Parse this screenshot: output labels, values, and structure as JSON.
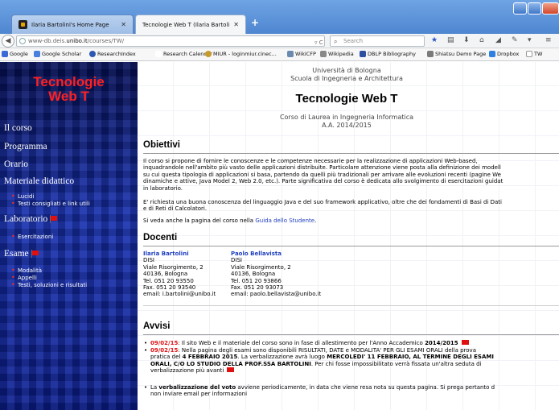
{
  "browser": {
    "tabs": [
      {
        "title": "Ilaria Bartolini's Home Page"
      },
      {
        "title": "Tecnologie Web T (Ilaria Bartolini)"
      }
    ],
    "new_tab": "+",
    "url_prefix": "www-db.deis.",
    "url_domain": "unibo.it",
    "url_path": "/courses/TW/",
    "search_placeholder": "Search",
    "bookmarks": [
      {
        "label": "Google",
        "color": "#3b6ad6"
      },
      {
        "label": "Google Scholar",
        "color": "#4a7fe0"
      },
      {
        "label": "ResearchIndex",
        "color": "#2c58b0"
      },
      {
        "label": "Research Calendar",
        "color": "#ffffff"
      },
      {
        "label": "MIUR - loginmiur.cinec...",
        "color": "#c79a2a"
      },
      {
        "label": "WikiCFP",
        "color": "#6a8ab0"
      },
      {
        "label": "Wikipedia",
        "color": "#888888"
      },
      {
        "label": "DBLP Bibliography",
        "color": "#2d4fa0"
      },
      {
        "label": "Shiatsu Demo Page",
        "color": "#7a7a7a"
      },
      {
        "label": "Dropbox",
        "color": "#2f7fe0"
      },
      {
        "label": "TW",
        "color": "#ffffff"
      }
    ]
  },
  "sidebar": {
    "site_title_line1": "Tecnologie",
    "site_title_line2": "Web T",
    "nav": {
      "corso": "Il corso",
      "programma": "Programma",
      "orario": "Orario",
      "materiale": "Materiale didattico",
      "lucidi": "Lucidi",
      "testi": "Testi consigliati e link utili",
      "laboratorio": "Laboratorio",
      "esercitazioni": "Esercitazioni",
      "esame": "Esame",
      "modalita": "Modalità",
      "appelli": "Appelli",
      "soluzioni": "Testi, soluzioni e risultati"
    }
  },
  "main": {
    "university": "Università di Bologna",
    "school": "Scuola di Ingegneria e Architettura",
    "title": "Tecnologie Web T",
    "degree": "Corso di Laurea in Ingegneria Informatica",
    "year": "A.A. 2014/2015",
    "obiettivi": {
      "heading": "Obiettivi",
      "p1_lines": [
        "Il corso si propone di fornire le conoscenze e le competenze necessarie per la realizzazione di applicazioni Web-based,",
        "inquadrandole nell'ambito più vasto delle applicazioni distribuite. Particolare attenzione viene posta alla definizione dei modell",
        "su cui questa tipologia di applicazioni si basa, partendo da quelli più tradizionali per arrivare alle evoluzioni recenti (pagine We",
        "dinamiche e attive, Java Model 2, Web 2.0, etc.). Parte significativa del corso è dedicata allo svolgimento di esercitazioni guidat",
        "in laboratorio."
      ],
      "p2_lines": [
        "E' richiesta una buona conoscenza del linguaggio Java e del suo framework applicativo, oltre che dei fondamenti di Basi di Dati",
        "e di Reti di Calcolatori."
      ],
      "p3_prefix": "Si veda anche la pagina del corso nella ",
      "p3_link": "Guida dello Studente",
      "p3_suffix": "."
    },
    "docenti": {
      "heading": "Docenti",
      "list": [
        {
          "name": "Ilaria Bartolini",
          "dept": "DISI",
          "street": "Viale Risorgimento, 2",
          "city": "40136, Bologna",
          "tel": "Tel. 051 20 93550",
          "fax": "Fax. 051 20 93540",
          "email": "email: i.bartolini@unibo.it"
        },
        {
          "name": "Paolo Bellavista",
          "dept": "DISI",
          "street": "Viale Risorgimento, 2",
          "city": "40136, Bologna",
          "tel": "Tel. 051 20 93866",
          "fax": "Fax. 051 20 93073",
          "email": "email: paolo.bellavista@unibo.it"
        }
      ]
    },
    "avvisi": {
      "heading": "Avvisi",
      "a1_date": "09/02/15",
      "a1_text": ": Il sito Web e il materiale del corso sono in fase di allestimento per l'Anno Accademico ",
      "a1_bold": "2014/2015",
      "a2_date": "09/02/15",
      "a2_l1": ": Nella pagina degli esami sono disponibili RISULTATI, DATE e MODALITA' PER GLI ESAMI ORALI della prova",
      "a2_l2a": "pratica del ",
      "a2_l2b": "4 FEBBRAIO 2015",
      "a2_l2c": ". La verbalizzazione avrà luogo ",
      "a2_l2d": "MERCOLEDI' 11 FEBBRAIO, AL TERMINE DEGLI ESAMI",
      "a2_l3a": "ORALI, C/O LO STUDIO DELLA PROF.SSA BARTOLINI",
      "a2_l3b": ". Per chi fosse impossibilitato verrà fissata un'altra seduta di",
      "a2_l4": "verbalizzazione più avanti",
      "a3_pre": "La ",
      "a3_bold": "verbalizzazione del voto",
      "a3_l1": " avviene periodicamente, in data che viene resa nota su questa pagina. Si prega pertanto d",
      "a3_l2": "non inviare email per informazioni"
    }
  }
}
